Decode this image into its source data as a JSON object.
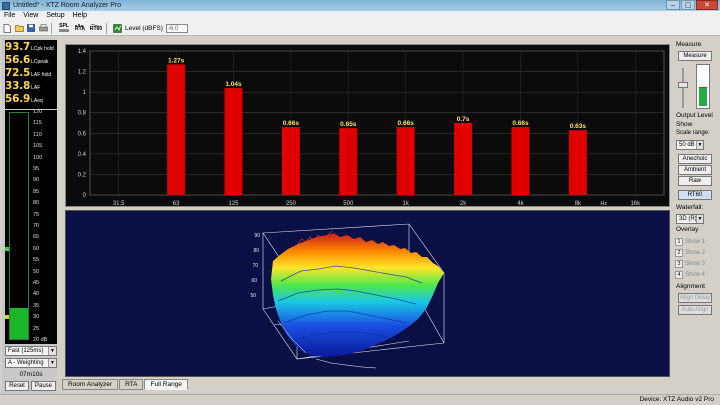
{
  "window": {
    "title": "Untitled* - XTZ Room Analyzer Pro",
    "min": "–",
    "max": "▢",
    "close": "✕"
  },
  "menu": [
    "File",
    "View",
    "Setup",
    "Help"
  ],
  "toolbar": {
    "new_icon": "new-document-icon",
    "open_icon": "open-folder-icon",
    "save_icon": "save-icon",
    "print_icon": "print-icon",
    "spl_label": "SPL",
    "rta_label": "RTA",
    "rt_label": "RT60",
    "level_label": "Level (dBFS)",
    "level_value": "-6.0"
  },
  "readouts": [
    {
      "value": "93.7",
      "label": "LCpk hold"
    },
    {
      "value": "56.6",
      "label": "LCpeak"
    },
    {
      "value": "72.5",
      "label": "LAF hold"
    },
    {
      "value": "33.8",
      "label": "LAF"
    },
    {
      "value": "56.9",
      "label": "LAeq"
    }
  ],
  "meter": {
    "ticks": [
      "120",
      "115",
      "110",
      "105",
      "100",
      "95",
      "90",
      "85",
      "80",
      "75",
      "70",
      "65",
      "60",
      "55",
      "50",
      "45",
      "40",
      "35",
      "30",
      "25",
      "20 dB"
    ],
    "min": 20,
    "max": 120,
    "level": 33.8,
    "green_mark": 60,
    "yellow_mark": 30
  },
  "left_controls": {
    "speed": "Fast (125ms)",
    "weighting": "A - Weighting",
    "elapsed": "07m10s",
    "reset": "Reset",
    "pause": "Pause"
  },
  "right_panel": {
    "measure_label": "Measure",
    "measure_button": "Measure",
    "output_level": "Output Level",
    "show_label": "Show",
    "scale_label": "Scale range:",
    "scale_value": "50 dB",
    "anechoic": "Anechoic",
    "ambient": "Ambient",
    "raw": "Raw",
    "rt60": "RT60",
    "waterfall_label": "Waterfall:",
    "waterfall_value": "3D (R)",
    "overlay_label": "Overlay",
    "shows": [
      {
        "num": "1",
        "label": "Show 1"
      },
      {
        "num": "2",
        "label": "Show 2"
      },
      {
        "num": "3",
        "label": "Show 3"
      },
      {
        "num": "4",
        "label": "Show 4"
      }
    ],
    "alignment_label": "Alignment",
    "align_delay": "Align Delay",
    "auto_align": "Auto Align"
  },
  "tabs": [
    "Room Analyzer",
    "RTA",
    "Full Range"
  ],
  "active_tab": 2,
  "status": {
    "device": "Device: XTZ Audio v2 Pro"
  },
  "chart_data": {
    "type": "bar",
    "categories": [
      "31.5",
      "63",
      "125",
      "250",
      "500",
      "1k",
      "2k",
      "4k",
      "8k",
      "16k"
    ],
    "x_unit": "Hz",
    "values": [
      null,
      1.27,
      1.04,
      0.66,
      0.65,
      0.66,
      0.7,
      0.66,
      0.63,
      null
    ],
    "data_labels": [
      "",
      "1.27s",
      "1.04s",
      "0.66s",
      "0.65s",
      "0.66s",
      "0.7s",
      "0.66s",
      "0.63s",
      ""
    ],
    "yticks": [
      "0",
      "0.2",
      "0.4",
      "0.6",
      "0.8",
      "1",
      "1.2",
      "1.4"
    ],
    "ylim": [
      0,
      1.4
    ],
    "bar_color": "#e00000",
    "label_color": "#ffe35a",
    "grid": true
  },
  "waterfall": {
    "type": "3d-waterfall",
    "z_ticks": [
      "90",
      "80",
      "70",
      "60",
      "50"
    ],
    "palette": [
      "#c81b1b",
      "#ff8a00",
      "#ffe52a",
      "#4fe84a",
      "#19c6e8",
      "#1b4ee0",
      "#0a1a9a"
    ]
  }
}
